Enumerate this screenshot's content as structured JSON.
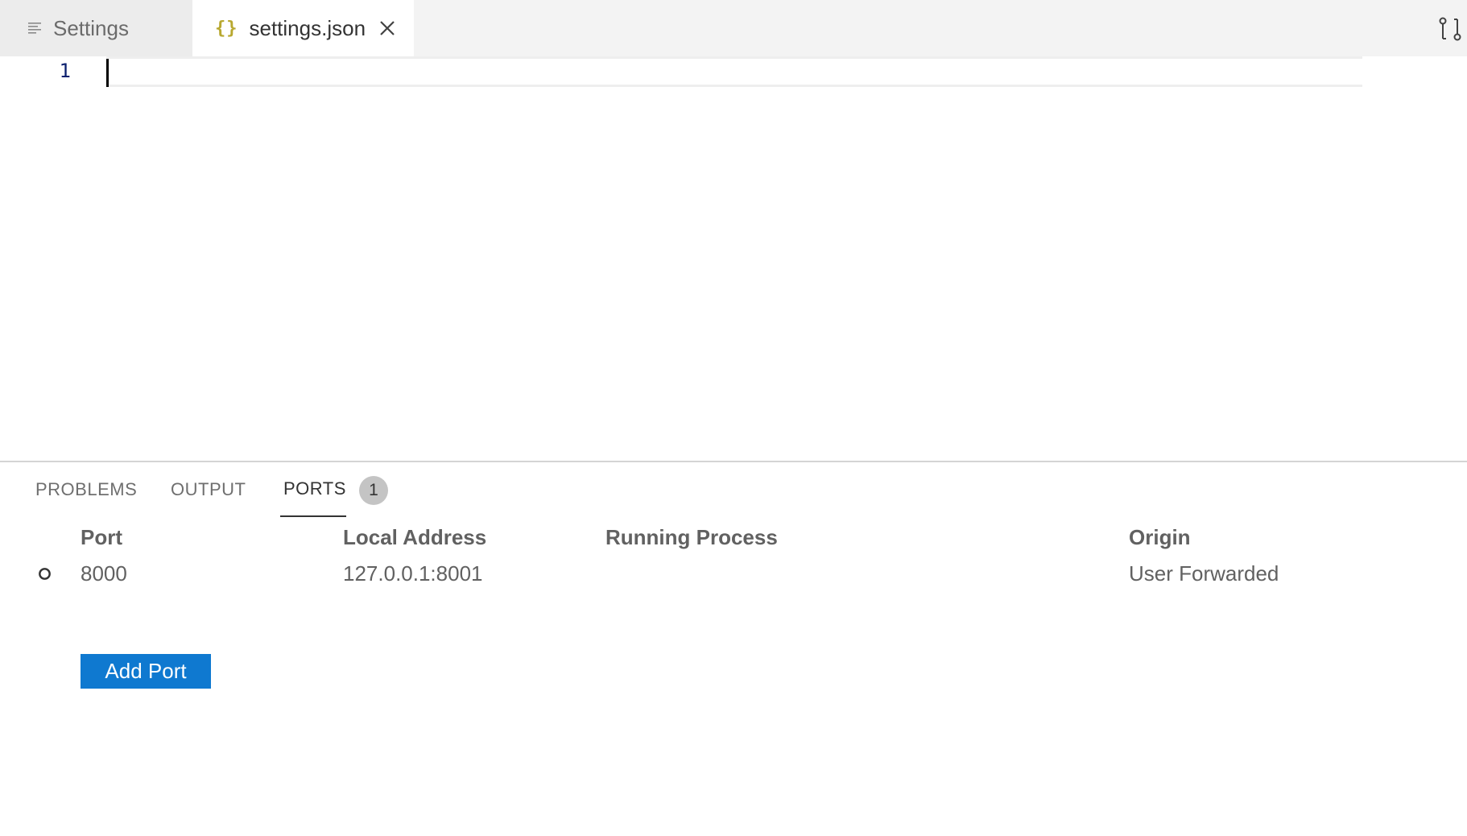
{
  "tabs": {
    "settings_label": "Settings",
    "json_label": "settings.json",
    "json_icon_glyph": "{}"
  },
  "editor": {
    "line_numbers": [
      "1"
    ]
  },
  "panel": {
    "tabs": {
      "problems": "PROBLEMS",
      "output": "OUTPUT",
      "ports": "PORTS"
    },
    "ports_badge": "1"
  },
  "ports": {
    "headers": {
      "port": "Port",
      "local_address": "Local Address",
      "running_process": "Running Process",
      "origin": "Origin"
    },
    "rows": [
      {
        "port": "8000",
        "local_address": "127.0.0.1:8001",
        "running_process": "",
        "origin": "User Forwarded"
      }
    ],
    "add_button": "Add Port"
  },
  "colors": {
    "accent_button": "#0f79d0",
    "json_icon": "#b8a830",
    "line_number": "#0b216f",
    "badge_bg": "#c4c4c4"
  },
  "icons": {
    "settings_tab": "lines-icon",
    "json_tab": "braces-icon",
    "close": "close-icon",
    "toolbar": "compare-changes-icon",
    "port_status": "circle-outline-icon"
  }
}
